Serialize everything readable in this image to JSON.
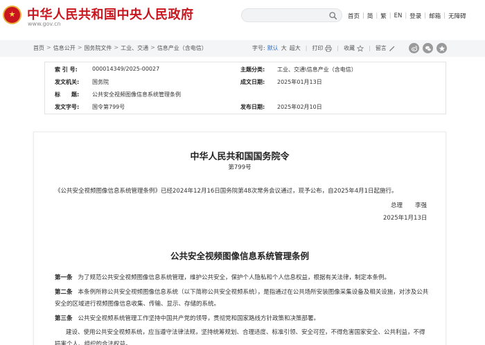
{
  "header": {
    "site_title": "中华人民共和国中央人民政府",
    "site_url": "www.gov.cn",
    "search_placeholder": "",
    "nav": [
      "首页",
      "简",
      "繁",
      "EN",
      "登录",
      "邮箱",
      "无障碍"
    ]
  },
  "breadcrumb": [
    "首页",
    "信息公开",
    "国务院文件",
    "工业、交通",
    "信息产业（含电信）"
  ],
  "tools": {
    "font_label": "字号:",
    "font_default": "默认",
    "font_large": "大",
    "font_xlarge": "超大",
    "print": "打印",
    "favorite": "收藏",
    "comment": "留言"
  },
  "meta": {
    "index_label": "索 引 号:",
    "index_value": "000014349/2025-00027",
    "topic_label": "主题分类:",
    "topic_value": "工业、交通\\信息产业（含电信）",
    "issuer_label": "发文机关:",
    "issuer_value": "国务院",
    "created_label": "成文日期:",
    "created_value": "2025年01月13日",
    "title_label": "标　　题:",
    "title_value": "公共安全视频图像信息系统管理条例",
    "docno_label": "发文字号:",
    "docno_value": "国令第799号",
    "published_label": "发布日期:",
    "published_value": "2025年02月10日"
  },
  "content": {
    "order_title": "中华人民共和国国务院令",
    "order_no": "第799号",
    "promulgation": "《公共安全视频图像信息系统管理条例》已经2024年12月16日国务院第48次常务会议通过，现予公布，自2025年4月1日起施行。",
    "signer_title": "总理",
    "signer_name": "李强",
    "sign_date": "2025年1月13日",
    "reg_title": "公共安全视频图像信息系统管理条例",
    "articles": [
      {
        "no": "第一条",
        "text": "为了规范公共安全视频图像信息系统管理，维护公共安全，保护个人隐私和个人信息权益，根据有关法律，制定本条例。"
      },
      {
        "no": "第二条",
        "text": "本条例所称公共安全视频图像信息系统（以下简称公共安全视频系统），是指通过在公共场所安装图像采集设备及相关设施，对涉及公共安全的区域进行视频图像信息收集、传输、显示、存储的系统。"
      },
      {
        "no": "第三条",
        "text": "公共安全视频系统管理工作坚持中国共产党的领导，贯彻党和国家路线方针政策和决策部署。"
      },
      {
        "no": "",
        "text": "建设、使用公共安全视频系统，应当遵守法律法规，坚持统筹规划、合理适度、标准引领、安全可控，不得危害国家安全、公共利益，不得损害个人、组织的合法权益。"
      }
    ]
  },
  "colors": {
    "brand_red": "#c9151e",
    "link_blue": "#2a6fc9"
  }
}
